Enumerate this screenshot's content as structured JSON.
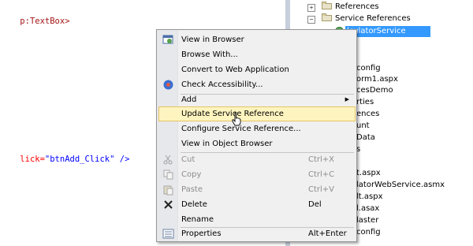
{
  "editor": {
    "line1": {
      "text": "p:TextBox>"
    },
    "line2": {
      "attr": "lick=",
      "val": "\"btnAdd_Click\"",
      "end": " />"
    }
  },
  "explorer": {
    "nodes": [
      {
        "label": "References"
      },
      {
        "label": "Service References"
      },
      {
        "label": "lculatorService"
      },
      {
        "label": "config"
      },
      {
        "label": "orm1.aspx"
      },
      {
        "label": "cesDemo"
      },
      {
        "label": "rties"
      },
      {
        "label": "ences"
      },
      {
        "label": "unt"
      },
      {
        "label": "Data"
      },
      {
        "label": "s"
      },
      {
        "label": "t.aspx"
      },
      {
        "label": "latorWebService.asmx"
      },
      {
        "label": "lt.aspx"
      },
      {
        "label": "l.asax"
      },
      {
        "label": "laster"
      },
      {
        "label": "config"
      }
    ]
  },
  "context_menu": {
    "items": [
      {
        "label": "View in Browser",
        "shortcut": ""
      },
      {
        "label": "Browse With...",
        "shortcut": ""
      },
      {
        "label": "Convert to Web Application",
        "shortcut": ""
      },
      {
        "label": "Check Accessibility...",
        "shortcut": ""
      },
      {
        "label": "Add",
        "shortcut": ""
      },
      {
        "label": "Update Service Reference",
        "shortcut": ""
      },
      {
        "label": "Configure Service Reference...",
        "shortcut": ""
      },
      {
        "label": "View in Object Browser",
        "shortcut": ""
      },
      {
        "label": "Cut",
        "shortcut": "Ctrl+X"
      },
      {
        "label": "Copy",
        "shortcut": "Ctrl+C"
      },
      {
        "label": "Paste",
        "shortcut": "Ctrl+V"
      },
      {
        "label": "Delete",
        "shortcut": "Del"
      },
      {
        "label": "Rename",
        "shortcut": ""
      },
      {
        "label": "Properties",
        "shortcut": "Alt+Enter"
      }
    ]
  },
  "colors": {
    "selection": "#3399ff",
    "menu_hover_bg": "#fdf4bf",
    "menu_hover_border": "#e5c365",
    "disabled_text": "#8d8d8d"
  }
}
